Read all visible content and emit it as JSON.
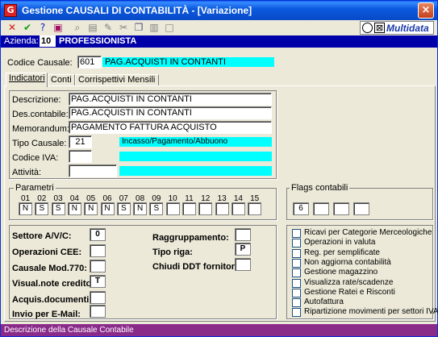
{
  "window": {
    "title": "Gestione CAUSALI DI CONTABILITÀ - [Variazione]",
    "close_glyph": "×"
  },
  "toolbar": {
    "buttons": [
      {
        "name": "cancel-icon",
        "glyph": "✕",
        "color": "#d01818"
      },
      {
        "name": "confirm-icon",
        "glyph": "✔",
        "color": "#10a010"
      },
      {
        "name": "help-icon",
        "glyph": "?",
        "color": "#1020c0"
      },
      {
        "name": "book-icon",
        "glyph": "▣",
        "color": "#a01060"
      },
      {
        "name": "search-icon",
        "glyph": "⌕",
        "color": "#707070"
      },
      {
        "name": "print-icon",
        "glyph": "▤",
        "color": "#808080"
      },
      {
        "name": "edit-icon",
        "glyph": "✎",
        "color": "#808080"
      },
      {
        "name": "delete-icon",
        "glyph": "✂",
        "color": "#808080"
      },
      {
        "name": "copy-icon",
        "glyph": "❐",
        "color": "#505080"
      },
      {
        "name": "paste-icon",
        "glyph": "▥",
        "color": "#808080"
      },
      {
        "name": "new-icon",
        "glyph": "□",
        "color": "#808080"
      }
    ],
    "brand": "Multidata",
    "brand_x": "⊠"
  },
  "azienda": {
    "label": "Azienda:",
    "code": "10",
    "name": "PROFESSIONISTA"
  },
  "codice_causale": {
    "label": "Codice Causale:",
    "code": "601",
    "description": "PAG.ACQUISTI IN CONTANTI"
  },
  "tabs": [
    "Indicatori",
    "Conti",
    "Corrispettivi Mensili"
  ],
  "main": {
    "descrizione": {
      "label": "Descrizione:",
      "value": "PAG.ACQUISTI IN CONTANTI"
    },
    "des_contabile": {
      "label": "Des.contabile:",
      "value": "PAG.ACQUISTI IN CONTANTI"
    },
    "memorandum": {
      "label": "Memorandum:",
      "value": "PAGAMENTO FATTURA ACQUISTO"
    },
    "tipo_causale": {
      "label": "Tipo Causale:",
      "value": "21",
      "description": "Incasso/Pagamento/Abbuono"
    },
    "codice_iva": {
      "label": "Codice IVA:",
      "value": ""
    },
    "attivita": {
      "label": "Attività:",
      "value": ""
    }
  },
  "parametri": {
    "title": "Parametri",
    "numbers": [
      "01",
      "02",
      "03",
      "04",
      "05",
      "06",
      "07",
      "08",
      "09",
      "10",
      "11",
      "12",
      "13",
      "14",
      "15"
    ],
    "values": [
      "N",
      "S",
      "S",
      "N",
      "N",
      "N",
      "S",
      "N",
      "S",
      "",
      "",
      "",
      "",
      "",
      ""
    ]
  },
  "flags": {
    "title": "Flags contabili",
    "values": [
      "6",
      "",
      "",
      ""
    ]
  },
  "settings": {
    "settore": {
      "label": "Settore A/V/C:",
      "value": "0"
    },
    "operazioni_cee": {
      "label": "Operazioni CEE:",
      "value": ""
    },
    "causale_770": {
      "label": "Causale Mod.770:",
      "value": ""
    },
    "visual_note": {
      "label": "Visual.note credito:",
      "value": "T"
    },
    "acquis": {
      "label": "Acquis.documenti:",
      "value": ""
    },
    "invio_email": {
      "label": "Invio per E-Mail:",
      "value": ""
    },
    "raggruppamento": {
      "label": "Raggruppamento:",
      "value": ""
    },
    "tipo_riga": {
      "label": "Tipo riga:",
      "value": "P"
    },
    "chiudi_ddt": {
      "label": "Chiudi DDT fornitori:",
      "value": ""
    }
  },
  "checkboxes": [
    "Ricavi per Categorie Merceologiche",
    "Operazioni in valuta",
    "Reg. per semplificate",
    "Non aggiorna contabilità",
    "Gestione magazzino",
    "Visualizza rate/scadenze",
    "Gestione Ratei e Risconti",
    "Autofattura",
    "Ripartizione movimenti per settori IVA"
  ],
  "status": "Descrizione della Causale Contabile"
}
